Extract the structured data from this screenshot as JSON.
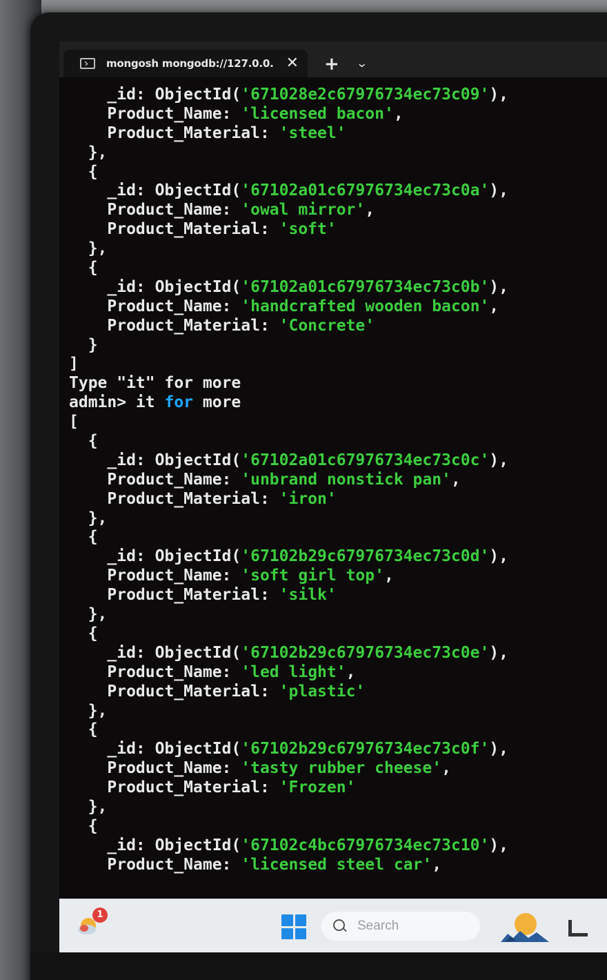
{
  "tab": {
    "title": "mongosh mongodb://127.0.0.",
    "close_glyph": "✕",
    "new_tab_glyph": "+",
    "dropdown_glyph": "⌄"
  },
  "terminal": {
    "colors": {
      "text": "#e9e9ea",
      "string": "#3ccd3f",
      "keyword": "#1ea8ff",
      "background": "#0c0a0a"
    },
    "lines": [
      {
        "indent": "    ",
        "parts": [
          {
            "t": "_id: ObjectId("
          },
          {
            "t": "'671028e2c67976734ec73c09'",
            "c": "str"
          },
          {
            "t": "),"
          }
        ]
      },
      {
        "indent": "    ",
        "parts": [
          {
            "t": "Product_Name: "
          },
          {
            "t": "'licensed bacon'",
            "c": "str"
          },
          {
            "t": ","
          }
        ]
      },
      {
        "indent": "    ",
        "parts": [
          {
            "t": "Product_Material: "
          },
          {
            "t": "'steel'",
            "c": "str"
          }
        ]
      },
      {
        "indent": "  ",
        "parts": [
          {
            "t": "},"
          }
        ]
      },
      {
        "indent": "  ",
        "parts": [
          {
            "t": "{"
          }
        ]
      },
      {
        "indent": "    ",
        "parts": [
          {
            "t": "_id: ObjectId("
          },
          {
            "t": "'67102a01c67976734ec73c0a'",
            "c": "str"
          },
          {
            "t": "),"
          }
        ]
      },
      {
        "indent": "    ",
        "parts": [
          {
            "t": "Product_Name: "
          },
          {
            "t": "'owal mirror'",
            "c": "str"
          },
          {
            "t": ","
          }
        ]
      },
      {
        "indent": "    ",
        "parts": [
          {
            "t": "Product_Material: "
          },
          {
            "t": "'soft'",
            "c": "str"
          }
        ]
      },
      {
        "indent": "  ",
        "parts": [
          {
            "t": "},"
          }
        ]
      },
      {
        "indent": "  ",
        "parts": [
          {
            "t": "{"
          }
        ]
      },
      {
        "indent": "    ",
        "parts": [
          {
            "t": "_id: ObjectId("
          },
          {
            "t": "'67102a01c67976734ec73c0b'",
            "c": "str"
          },
          {
            "t": "),"
          }
        ]
      },
      {
        "indent": "    ",
        "parts": [
          {
            "t": "Product_Name: "
          },
          {
            "t": "'handcrafted wooden bacon'",
            "c": "str"
          },
          {
            "t": ","
          }
        ]
      },
      {
        "indent": "    ",
        "parts": [
          {
            "t": "Product_Material: "
          },
          {
            "t": "'Concrete'",
            "c": "str"
          }
        ]
      },
      {
        "indent": "  ",
        "parts": [
          {
            "t": "}"
          }
        ]
      },
      {
        "indent": "",
        "parts": [
          {
            "t": "]"
          }
        ]
      },
      {
        "indent": "",
        "parts": [
          {
            "t": "Type \"it\" for more"
          }
        ]
      },
      {
        "indent": "",
        "parts": [
          {
            "t": "admin> it "
          },
          {
            "t": "for",
            "c": "kw"
          },
          {
            "t": " more"
          }
        ]
      },
      {
        "indent": "",
        "parts": [
          {
            "t": "["
          }
        ]
      },
      {
        "indent": "  ",
        "parts": [
          {
            "t": "{"
          }
        ]
      },
      {
        "indent": "    ",
        "parts": [
          {
            "t": "_id: ObjectId("
          },
          {
            "t": "'67102a01c67976734ec73c0c'",
            "c": "str"
          },
          {
            "t": "),"
          }
        ]
      },
      {
        "indent": "    ",
        "parts": [
          {
            "t": "Product_Name: "
          },
          {
            "t": "'unbrand nonstick pan'",
            "c": "str"
          },
          {
            "t": ","
          }
        ]
      },
      {
        "indent": "    ",
        "parts": [
          {
            "t": "Product_Material: "
          },
          {
            "t": "'iron'",
            "c": "str"
          }
        ]
      },
      {
        "indent": "  ",
        "parts": [
          {
            "t": "},"
          }
        ]
      },
      {
        "indent": "  ",
        "parts": [
          {
            "t": "{"
          }
        ]
      },
      {
        "indent": "    ",
        "parts": [
          {
            "t": "_id: ObjectId("
          },
          {
            "t": "'67102b29c67976734ec73c0d'",
            "c": "str"
          },
          {
            "t": "),"
          }
        ]
      },
      {
        "indent": "    ",
        "parts": [
          {
            "t": "Product_Name: "
          },
          {
            "t": "'soft girl top'",
            "c": "str"
          },
          {
            "t": ","
          }
        ]
      },
      {
        "indent": "    ",
        "parts": [
          {
            "t": "Product_Material: "
          },
          {
            "t": "'silk'",
            "c": "str"
          }
        ]
      },
      {
        "indent": "  ",
        "parts": [
          {
            "t": "},"
          }
        ]
      },
      {
        "indent": "  ",
        "parts": [
          {
            "t": "{"
          }
        ]
      },
      {
        "indent": "    ",
        "parts": [
          {
            "t": "_id: ObjectId("
          },
          {
            "t": "'67102b29c67976734ec73c0e'",
            "c": "str"
          },
          {
            "t": "),"
          }
        ]
      },
      {
        "indent": "    ",
        "parts": [
          {
            "t": "Product_Name: "
          },
          {
            "t": "'led light'",
            "c": "str"
          },
          {
            "t": ","
          }
        ]
      },
      {
        "indent": "    ",
        "parts": [
          {
            "t": "Product_Material: "
          },
          {
            "t": "'plastic'",
            "c": "str"
          }
        ]
      },
      {
        "indent": "  ",
        "parts": [
          {
            "t": "},"
          }
        ]
      },
      {
        "indent": "  ",
        "parts": [
          {
            "t": "{"
          }
        ]
      },
      {
        "indent": "    ",
        "parts": [
          {
            "t": "_id: ObjectId("
          },
          {
            "t": "'67102b29c67976734ec73c0f'",
            "c": "str"
          },
          {
            "t": "),"
          }
        ]
      },
      {
        "indent": "    ",
        "parts": [
          {
            "t": "Product_Name: "
          },
          {
            "t": "'tasty rubber cheese'",
            "c": "str"
          },
          {
            "t": ","
          }
        ]
      },
      {
        "indent": "    ",
        "parts": [
          {
            "t": "Product_Material: "
          },
          {
            "t": "'Frozen'",
            "c": "str"
          }
        ]
      },
      {
        "indent": "  ",
        "parts": [
          {
            "t": "},"
          }
        ]
      },
      {
        "indent": "  ",
        "parts": [
          {
            "t": "{"
          }
        ]
      },
      {
        "indent": "    ",
        "parts": [
          {
            "t": "_id: ObjectId("
          },
          {
            "t": "'67102c4bc67976734ec73c10'",
            "c": "str"
          },
          {
            "t": "),"
          }
        ]
      },
      {
        "indent": "    ",
        "parts": [
          {
            "t": "Product_Name: "
          },
          {
            "t": "'licensed steel car'",
            "c": "str"
          },
          {
            "t": ","
          }
        ]
      }
    ]
  },
  "taskbar": {
    "notification_count": "1",
    "search_placeholder": "Search",
    "icons": [
      "weather-icon",
      "windows-start-icon",
      "search-icon",
      "widgets-icon",
      "task-view-icon"
    ]
  }
}
